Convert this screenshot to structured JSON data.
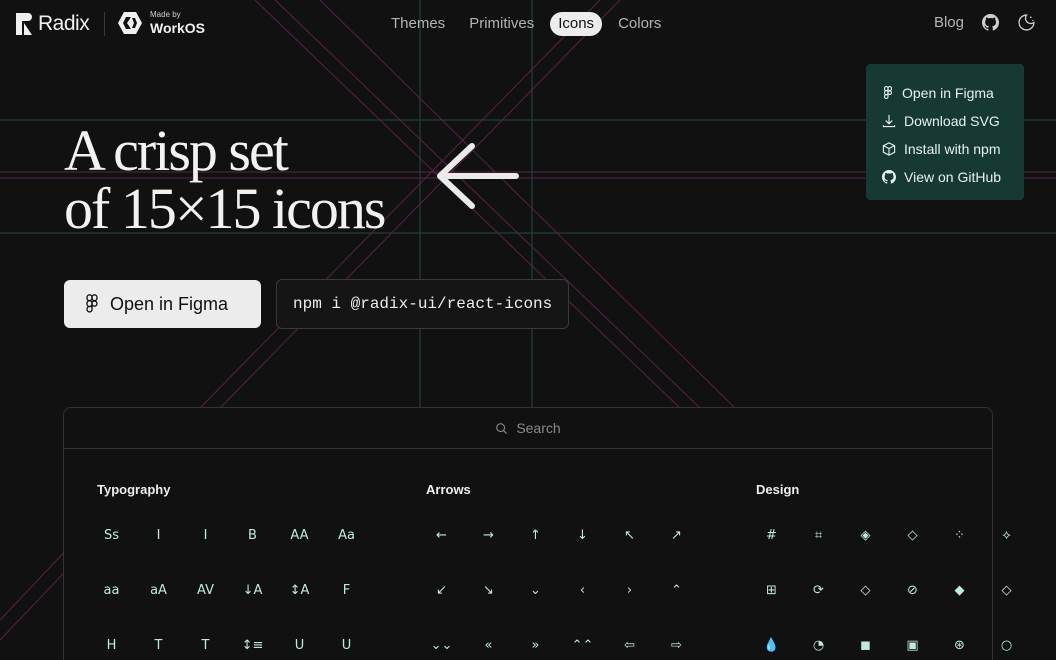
{
  "header": {
    "logo": "Radix",
    "made_by": "Made by",
    "workos": "WorkOS",
    "nav": [
      "Themes",
      "Primitives",
      "Icons",
      "Colors"
    ],
    "active_nav": "Icons",
    "blog": "Blog"
  },
  "hero": {
    "line1": "A crisp set",
    "line2": "of 15×15 icons",
    "figma_button": "Open in Figma",
    "npm_command": "npm i @radix-ui/react-icons"
  },
  "dropdown": {
    "items": [
      {
        "label": "Open in Figma",
        "icon": "figma-icon"
      },
      {
        "label": "Download SVG",
        "icon": "download-icon"
      },
      {
        "label": "Install with npm",
        "icon": "cube-icon"
      },
      {
        "label": "View on GitHub",
        "icon": "github-icon"
      }
    ]
  },
  "panel": {
    "search_placeholder": "Search",
    "categories": [
      {
        "title": "Typography",
        "icons": [
          "letter-case-toggle",
          "font-italic",
          "font-roman",
          "font-bold",
          "letter-case-uppercase",
          "letter-case-capitalize",
          "letter-case-lowercase",
          "letter-case-toggle-alt",
          "letter-spacing",
          "text-align-bottom",
          "line-height",
          "strikethrough-font",
          "heading",
          "text",
          "text-none",
          "line-spacing",
          "underline",
          "strikethrough"
        ],
        "glyphs": [
          "Sꜱ",
          "I",
          "I",
          "B",
          "AA",
          "Aa",
          "aa",
          "aA",
          "AV",
          "↓A",
          "↕A",
          "F",
          "H",
          "T",
          "T",
          "↕≡",
          "U",
          "U"
        ]
      },
      {
        "title": "Arrows",
        "icons": [
          "arrow-left",
          "arrow-right",
          "arrow-up",
          "arrow-down",
          "arrow-top-left",
          "arrow-top-right",
          "arrow-bottom-left",
          "arrow-bottom-right",
          "chevron-down",
          "chevron-left",
          "chevron-right",
          "chevron-up",
          "double-arrow-down",
          "double-arrow-left",
          "double-arrow-right",
          "double-arrow-up",
          "thick-arrow-left",
          "thick-arrow-right"
        ],
        "glyphs": [
          "←",
          "→",
          "↑",
          "↓",
          "↖",
          "↗",
          "↙",
          "↘",
          "⌄",
          "‹",
          "›",
          "⌃",
          "⌄⌄",
          "«",
          "»",
          "⌃⌃",
          "⇦",
          "⇨"
        ]
      },
      {
        "title": "Design",
        "icons": [
          "frame",
          "crop",
          "layers",
          "stack",
          "component-1",
          "component-2",
          "grid",
          "reload",
          "component-instance",
          "component-none",
          "component-boolean",
          "dash-diamond",
          "drop",
          "opacity",
          "mask-on",
          "mask-off",
          "aperture",
          "shadow"
        ],
        "glyphs": [
          "#",
          "⌗",
          "◈",
          "◇",
          "⁘",
          "⟡",
          "⊞",
          "⟳",
          "◇",
          "⊘",
          "◆",
          "◇",
          "💧",
          "◔",
          "◼",
          "▣",
          "⊛",
          "○"
        ]
      }
    ]
  }
}
